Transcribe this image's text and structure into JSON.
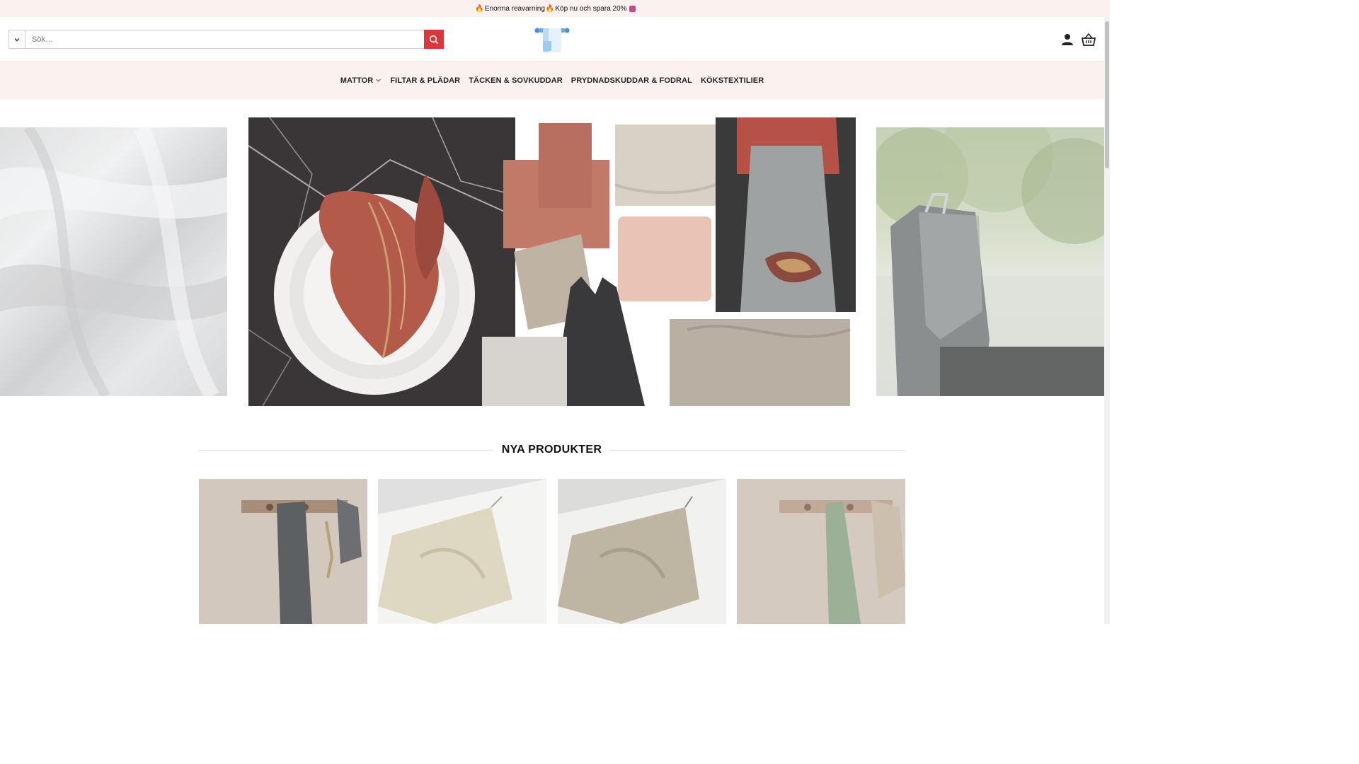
{
  "promo": {
    "text_a": "Enorma reavarning",
    "text_b": "Köp nu och spara 20%"
  },
  "search": {
    "placeholder": "Sök…"
  },
  "nav": {
    "items": [
      {
        "label": "MATTOR",
        "has_dropdown": true
      },
      {
        "label": "FILTAR & PLÄDAR"
      },
      {
        "label": "TÄCKEN & SOVKUDDAR"
      },
      {
        "label": "PRYDNADSKUDDAR & FODRAL"
      },
      {
        "label": "KÖKSTEXTILIER"
      }
    ]
  },
  "section": {
    "title": "NYA PRODUKTER"
  },
  "colors": {
    "accent": "#d9363e",
    "topbar_bg": "#fbf1ee",
    "logo_blue": "#4a8fd6"
  },
  "icons": {
    "search": "search-icon",
    "user": "user-icon",
    "cart": "basket-icon",
    "chevron": "chevron-down-icon"
  }
}
